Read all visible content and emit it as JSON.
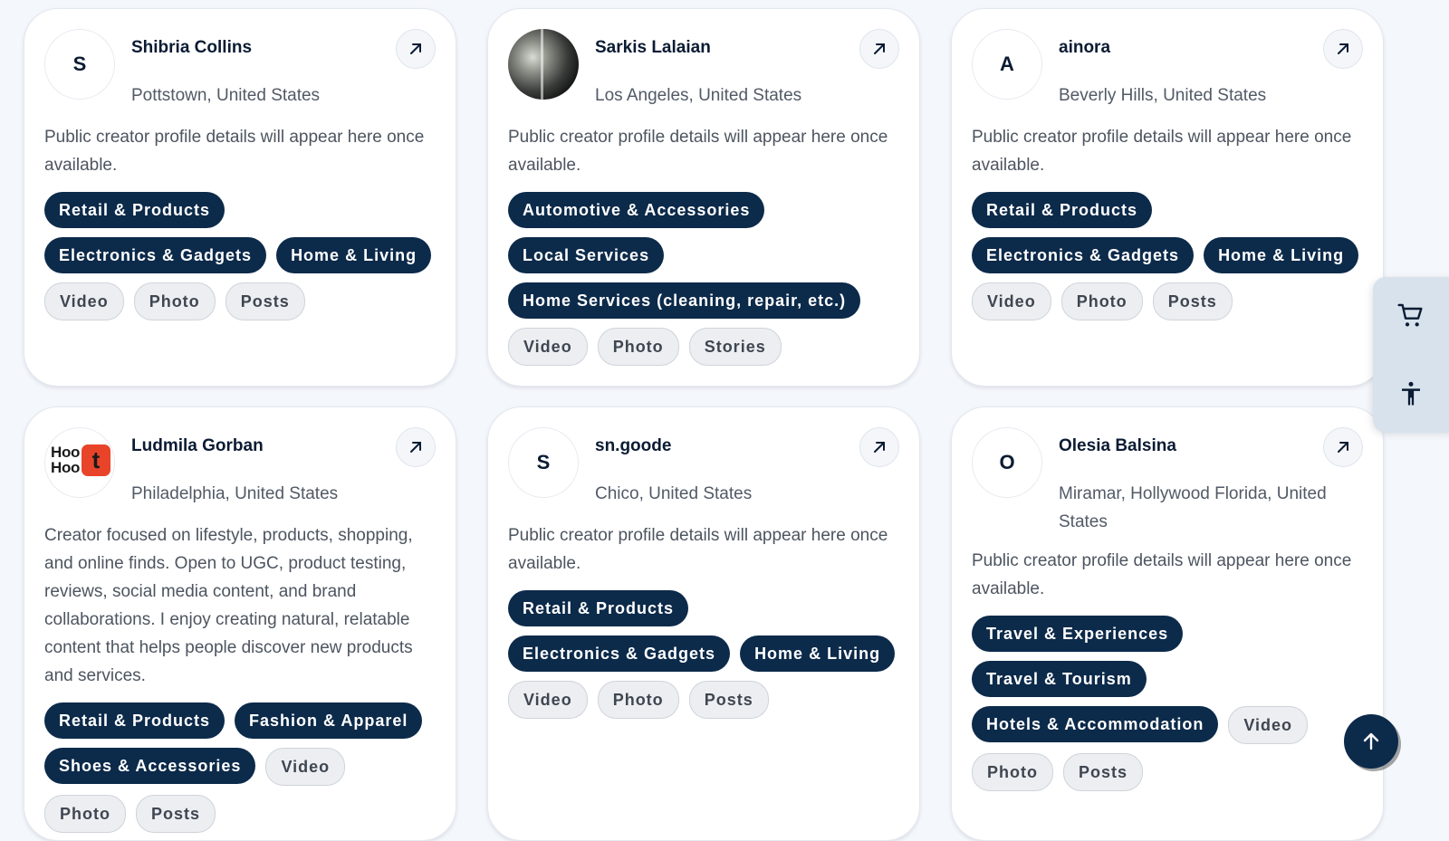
{
  "creators": [
    {
      "name": "Shibria Collins",
      "initial": "S",
      "location": "Pottstown, United States",
      "description": "Public creator profile details will appear here once available.",
      "categories": [
        "Retail & Products",
        "Electronics & Gadgets",
        "Home & Living"
      ],
      "formats": [
        "Video",
        "Photo",
        "Posts"
      ]
    },
    {
      "name": "Sarkis Lalaian",
      "initial": "",
      "location": "Los Angeles, United States",
      "description": "Public creator profile details will appear here once available.",
      "categories": [
        "Automotive & Accessories",
        "Local Services",
        "Home Services (cleaning, repair, etc.)"
      ],
      "formats": [
        "Video",
        "Photo",
        "Stories"
      ]
    },
    {
      "name": "ainora",
      "initial": "A",
      "location": "Beverly Hills, United States",
      "description": "Public creator profile details will appear here once available.",
      "categories": [
        "Retail & Products",
        "Electronics & Gadgets",
        "Home & Living"
      ],
      "formats": [
        "Video",
        "Photo",
        "Posts"
      ]
    },
    {
      "name": "Ludmila Gorban",
      "avatar_text": "Hoo Hoo",
      "avatar_tile": "t",
      "location": "Philadelphia, United States",
      "description": "Creator focused on lifestyle, products, shopping, and online finds. Open to UGC, product testing, reviews, social media content, and brand collaborations. I enjoy creating natural, relatable content that helps people discover new products and services.",
      "categories": [
        "Retail & Products",
        "Fashion & Apparel",
        "Shoes & Accessories"
      ],
      "formats": [
        "Video",
        "Photo",
        "Posts"
      ]
    },
    {
      "name": "sn.goode",
      "initial": "S",
      "location": "Chico, United States",
      "description": "Public creator profile details will appear here once available.",
      "categories": [
        "Retail & Products",
        "Electronics & Gadgets",
        "Home & Living"
      ],
      "formats": [
        "Video",
        "Photo",
        "Posts"
      ]
    },
    {
      "name": "Olesia Balsina",
      "initial": "O",
      "location": "Miramar, Hollywood Florida, United States",
      "description": "Public creator profile details will appear here once available.",
      "categories": [
        "Travel & Experiences",
        "Travel & Tourism",
        "Hotels & Accommodation"
      ],
      "formats": [
        "Video",
        "Photo",
        "Posts"
      ]
    }
  ],
  "icons": {
    "open_profile": "arrow-up-right-icon",
    "cart": "cart-icon",
    "accessibility": "accessibility-icon",
    "scroll_top": "arrow-up-icon"
  },
  "colors": {
    "category_tag": "#0c2a4a",
    "format_tag": "#eceef1",
    "page_bg": "#f4f7fb"
  }
}
